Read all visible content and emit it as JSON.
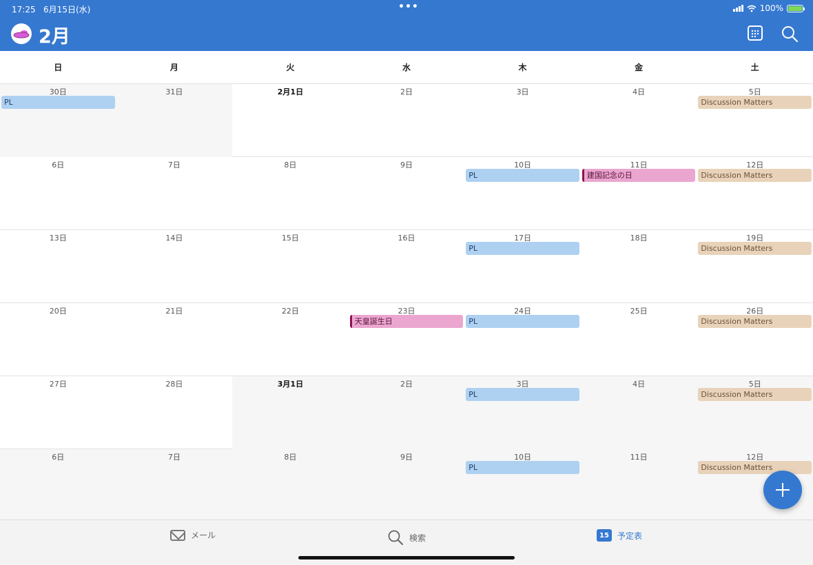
{
  "status_bar": {
    "time": "17:25",
    "date": "6月15日(水)",
    "battery": "100%",
    "battery_level": 1.0
  },
  "header": {
    "month": "2月",
    "grid_icon": "grid-icon",
    "search_icon": "search-icon"
  },
  "weekdays": [
    "日",
    "月",
    "火",
    "水",
    "木",
    "金",
    "土"
  ],
  "weeks": [
    {
      "days": [
        "30日",
        "31日",
        "2月1日",
        "2日",
        "3日",
        "4日",
        "5日"
      ]
    },
    {
      "days": [
        "6日",
        "7日",
        "8日",
        "9日",
        "10日",
        "11日",
        "12日"
      ]
    },
    {
      "days": [
        "13日",
        "14日",
        "15日",
        "16日",
        "17日",
        "18日",
        "19日"
      ]
    },
    {
      "days": [
        "20日",
        "21日",
        "22日",
        "23日",
        "24日",
        "25日",
        "26日"
      ]
    },
    {
      "days": [
        "27日",
        "28日",
        "3月1日",
        "2日",
        "3日",
        "4日",
        "5日"
      ]
    },
    {
      "days": [
        "6日",
        "7日",
        "8日",
        "9日",
        "10日",
        "11日",
        "12日"
      ]
    }
  ],
  "events": {
    "pl": "PL",
    "discussion": "Discussion Matters",
    "kenkoku": "建国記念の日",
    "tenno": "天皇誕生日"
  },
  "tabbar": {
    "mail": "メール",
    "search": "検索",
    "calendar": "予定表",
    "calendar_badge": "15"
  },
  "colors": {
    "accent": "#3578d0",
    "pl": "#aed1f2",
    "discussion": "#e8d3ba",
    "holiday": "#eba6cf"
  }
}
